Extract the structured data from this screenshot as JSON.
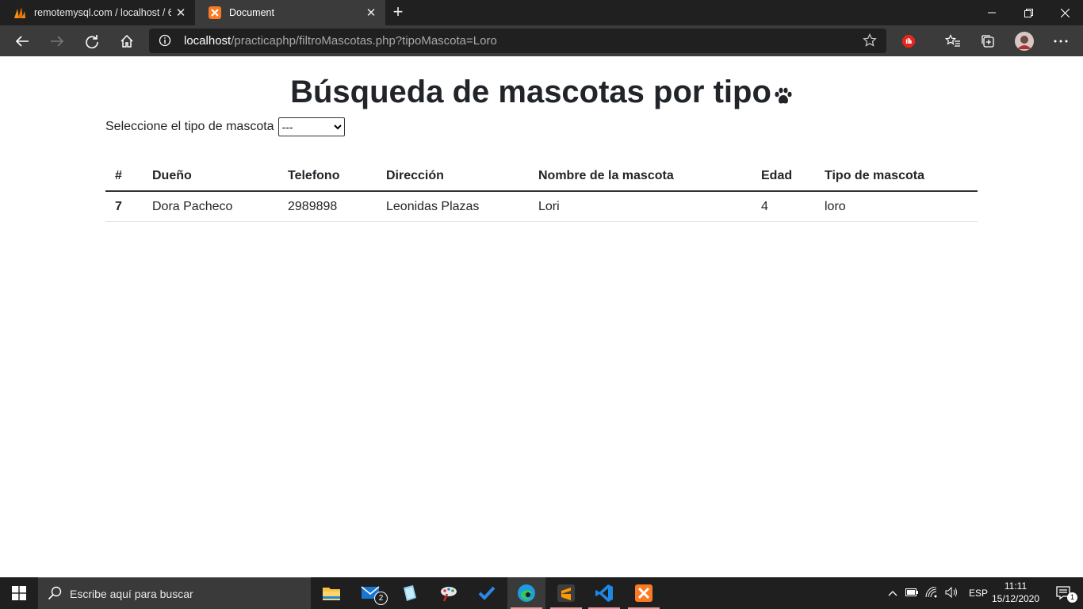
{
  "browser": {
    "tabs": [
      {
        "title": "remotemysql.com / localhost / 6",
        "active": false
      },
      {
        "title": "Document",
        "active": true
      }
    ],
    "address": {
      "host": "localhost",
      "path": "/practicaphp/filtroMascotas.php?tipoMascota=Loro"
    }
  },
  "page": {
    "title": "Búsqueda de mascotas por tipo",
    "filter_label": "Seleccione el tipo de mascota",
    "filter_value": "---",
    "table": {
      "headers": [
        "#",
        "Dueño",
        "Telefono",
        "Dirección",
        "Nombre de la mascota",
        "Edad",
        "Tipo de mascota"
      ],
      "rows": [
        [
          "7",
          "Dora Pacheco",
          "2989898",
          "Leonidas Plazas",
          "Lori",
          "4",
          "loro"
        ]
      ]
    }
  },
  "taskbar": {
    "search_placeholder": "Escribe aquí para buscar",
    "mail_badge": "2",
    "language": "ESP",
    "time": "11:11",
    "date": "15/12/2020",
    "notification_count": "1"
  }
}
